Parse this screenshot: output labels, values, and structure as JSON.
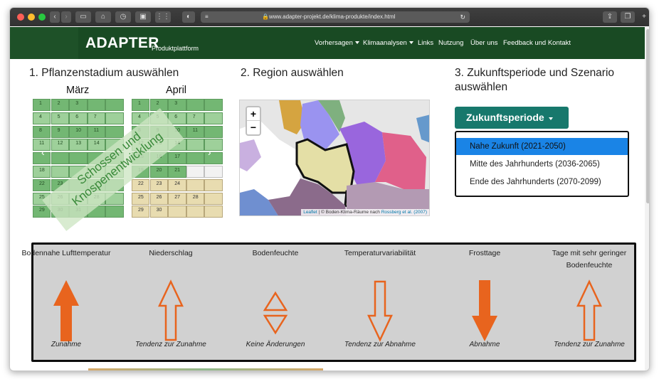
{
  "browser": {
    "url": "www.adapter-projekt.de/klima-produkte/index.html"
  },
  "navbar": {
    "brand": "ADAPTER",
    "brand_sub": "Produktplattform",
    "items": [
      {
        "label": "Vorhersagen",
        "dropdown": true
      },
      {
        "label": "Klimaanalysen",
        "dropdown": true
      },
      {
        "label": "Links",
        "dropdown": false
      },
      {
        "label": "Nutzung",
        "dropdown": false
      },
      {
        "label": "Über uns",
        "dropdown": false
      },
      {
        "label": "Feedback und Kontakt",
        "dropdown": false
      }
    ]
  },
  "sections": {
    "s1": "1. Pflanzenstadium auswählen",
    "s2": "2. Region auswählen",
    "s3": "3. Zukunftsperiode und Szenario auswählen"
  },
  "calendar": {
    "march": {
      "label": "März",
      "days": [
        "1",
        "2",
        "3",
        "",
        "",
        "4",
        "5",
        "6",
        "7",
        "",
        "8",
        "9",
        "10",
        "11",
        "",
        "11",
        "12",
        "13",
        "14",
        "",
        "",
        "",
        "",
        "",
        "",
        "18",
        "",
        "",
        "",
        "",
        "22",
        "23",
        "",
        "",
        "",
        "25",
        "26",
        "27",
        "28",
        "",
        "29",
        "30",
        "31",
        "",
        ""
      ]
    },
    "april": {
      "label": "April",
      "days": [
        "1",
        "2",
        "3",
        "",
        "",
        "4",
        "5",
        "6",
        "7",
        "",
        "8",
        "9",
        "10",
        "11",
        "",
        "12",
        "13",
        "14",
        "",
        "",
        "15",
        "16",
        "17",
        "",
        "",
        "19",
        "20",
        "21",
        "",
        "",
        "22",
        "23",
        "24",
        "",
        "",
        "25",
        "26",
        "27",
        "28",
        "",
        "29",
        "30",
        "",
        "",
        ""
      ]
    },
    "overlay": [
      "Schossen und",
      "Knospenentwicklung"
    ],
    "nav_prev": "‹",
    "nav_next": "›"
  },
  "map": {
    "zoom_in": "+",
    "zoom_out": "−",
    "attribution_lib": "Leaflet",
    "attribution_mid": "| © Boden-Klima-Räume nach",
    "attribution_src": "Rossberg et al. (2007)"
  },
  "period": {
    "button": "Zukunftsperiode",
    "options": [
      {
        "label": "Nahe Zukunft (2021-2050)",
        "active": true
      },
      {
        "label": "Mitte des Jahrhunderts (2036-2065)",
        "active": false
      },
      {
        "label": "Ende des Jahrhunderts (2070-2099)",
        "active": false
      }
    ]
  },
  "indicators": [
    {
      "label": "Bodennahe Lufttemperatur",
      "trend": "Zunahme",
      "icon": "arrow-up-filled"
    },
    {
      "label": "Niederschlag",
      "trend": "Tendenz zur Zunahme",
      "icon": "arrow-up-outline"
    },
    {
      "label": "Bodenfeuchte",
      "trend": "Keine Änderungen",
      "icon": "arrows-up-down-outline"
    },
    {
      "label": "Temperaturvariabilität",
      "trend": "Tendenz zur Abnahme",
      "icon": "arrow-down-outline"
    },
    {
      "label": "Frosttage",
      "trend": "Abnahme",
      "icon": "arrow-down-filled"
    },
    {
      "label": "Tage mit sehr geringer Bodenfeuchte",
      "trend": "Tendenz zur Zunahme",
      "icon": "arrow-up-outline"
    }
  ],
  "colors": {
    "navbar": "#1e5128",
    "accent": "#17786c",
    "active_option": "#1a84e6",
    "arrow": "#e8641e"
  }
}
